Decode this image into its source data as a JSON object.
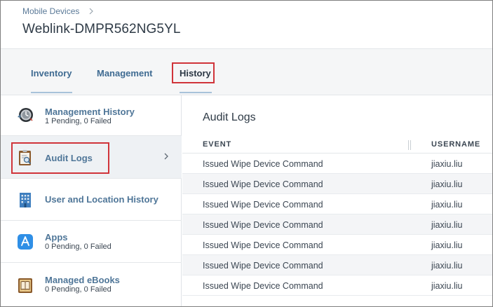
{
  "breadcrumb": {
    "parent": "Mobile Devices"
  },
  "page": {
    "title": "Weblink-DMPR562NG5YL"
  },
  "tabs": [
    {
      "label": "Inventory"
    },
    {
      "label": "Management"
    },
    {
      "label": "History"
    }
  ],
  "active_tab": "History",
  "sidebar": {
    "items": [
      {
        "label": "Management History",
        "sub": "1 Pending, 0 Failed",
        "icon": "management-history-icon"
      },
      {
        "label": "Audit Logs",
        "sub": "",
        "icon": "audit-logs-icon"
      },
      {
        "label": "User and Location History",
        "sub": "",
        "icon": "building-icon"
      },
      {
        "label": "Apps",
        "sub": "0 Pending, 0 Failed",
        "icon": "app-store-icon"
      },
      {
        "label": "Managed eBooks",
        "sub": "0 Pending, 0 Failed",
        "icon": "ebook-icon"
      }
    ],
    "active_item": "Audit Logs"
  },
  "main": {
    "title": "Audit Logs",
    "columns": {
      "event": "EVENT",
      "username": "USERNAME"
    },
    "rows": [
      {
        "event": "Issued Wipe Device Command",
        "username": "jiaxiu.liu"
      },
      {
        "event": "Issued Wipe Device Command",
        "username": "jiaxiu.liu"
      },
      {
        "event": "Issued Wipe Device Command",
        "username": "jiaxiu.liu"
      },
      {
        "event": "Issued Wipe Device Command",
        "username": "jiaxiu.liu"
      },
      {
        "event": "Issued Wipe Device Command",
        "username": "jiaxiu.liu"
      },
      {
        "event": "Issued Wipe Device Command",
        "username": "jiaxiu.liu"
      },
      {
        "event": "Issued Wipe Device Command",
        "username": "jiaxiu.liu"
      }
    ]
  },
  "colors": {
    "link": "#4f7698",
    "highlight": "#d0343a",
    "band": "#f5f6f7"
  }
}
